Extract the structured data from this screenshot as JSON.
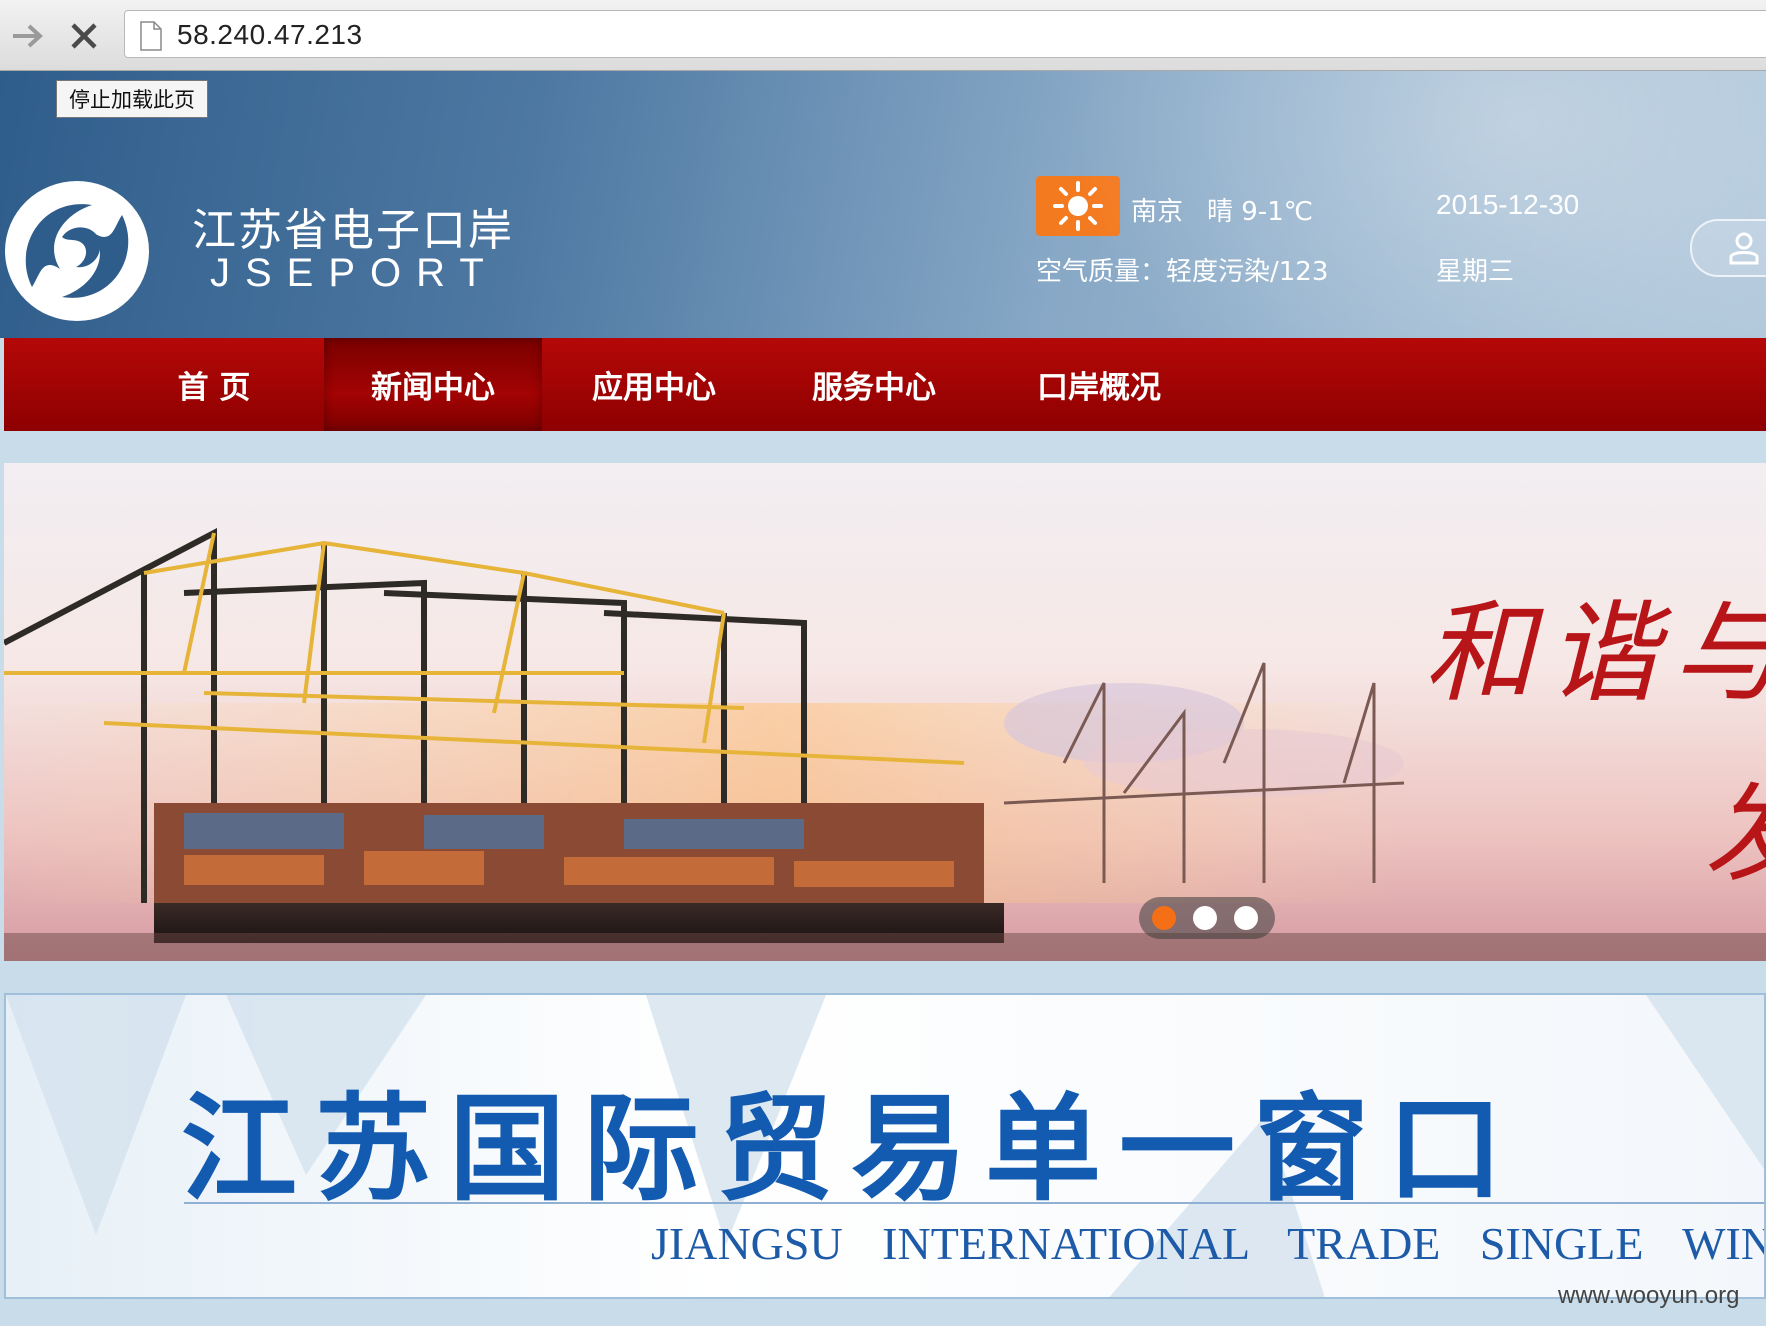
{
  "browser": {
    "url": "58.240.47.213",
    "tooltip": "停止加载此页"
  },
  "site": {
    "name": "江苏省电子口岸",
    "name_en": "JSEPORT",
    "weather": {
      "icon": "sun-icon",
      "city": "南京",
      "condition": "晴 9-1℃",
      "air_quality": "空气质量：轻度污染/123"
    },
    "date": "2015-12-30",
    "weekday": "星期三"
  },
  "nav": {
    "items": [
      "首 页",
      "新闻中心",
      "应用中心",
      "服务中心",
      "口岸概况"
    ],
    "active_index": 1
  },
  "banner": {
    "text_line1": "和谐与",
    "text_line2": "发",
    "slides": 3,
    "active_slide": 0
  },
  "single_window": {
    "title": "江苏国际贸易单一窗口",
    "title_en": "JIANGSU INTERNATIONAL TRADE SINGLE WINDOW"
  },
  "watermark": "www.wooyun.org",
  "colors": {
    "nav_red": "#a30303",
    "weather_orange": "#f47a20",
    "title_blue": "#135bb0",
    "dot_active": "#f46f16"
  }
}
